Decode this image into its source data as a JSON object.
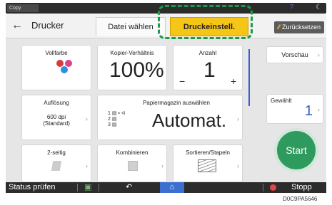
{
  "topbar": {
    "mode_label": "Copy",
    "help_icon": "question-icon",
    "moon_icon": "moon-icon"
  },
  "header": {
    "title": "Drucker",
    "tabs": [
      {
        "label": "Datei wählen",
        "active": false
      },
      {
        "label": "Druckeinstell.",
        "active": true
      }
    ],
    "reset_label": "Zurücksetzen"
  },
  "tiles": {
    "color": {
      "label": "Vollfarbe"
    },
    "ratio": {
      "label": "Kopier-Verhältnis",
      "value": "100%"
    },
    "quantity": {
      "label": "Anzahl",
      "value": "1",
      "minus": "−",
      "plus": "+"
    },
    "resolution": {
      "label": "Auflösung",
      "value": "600 dpi (Standard)"
    },
    "tray": {
      "label": "Papiermagazin auswählen",
      "value": "Automat.",
      "trays": [
        "1",
        "2",
        "3"
      ]
    },
    "duplex": {
      "label": "2-seitig"
    },
    "combine": {
      "label": "Kombinieren"
    },
    "sort": {
      "label": "Sortieren/Stapeln"
    }
  },
  "side": {
    "preview_label": "Vorschau",
    "selected_label": "Gewählt",
    "selected_count": "1",
    "start_label": "Start"
  },
  "bottombar": {
    "status_label": "Status prüfen",
    "stop_label": "Stopp"
  },
  "figure_code": "D0C9PA5646",
  "colors": {
    "accent": "#f5c518",
    "start": "#2f9a5e",
    "highlight": "#1a9a4a",
    "home": "#3b6fd0"
  }
}
